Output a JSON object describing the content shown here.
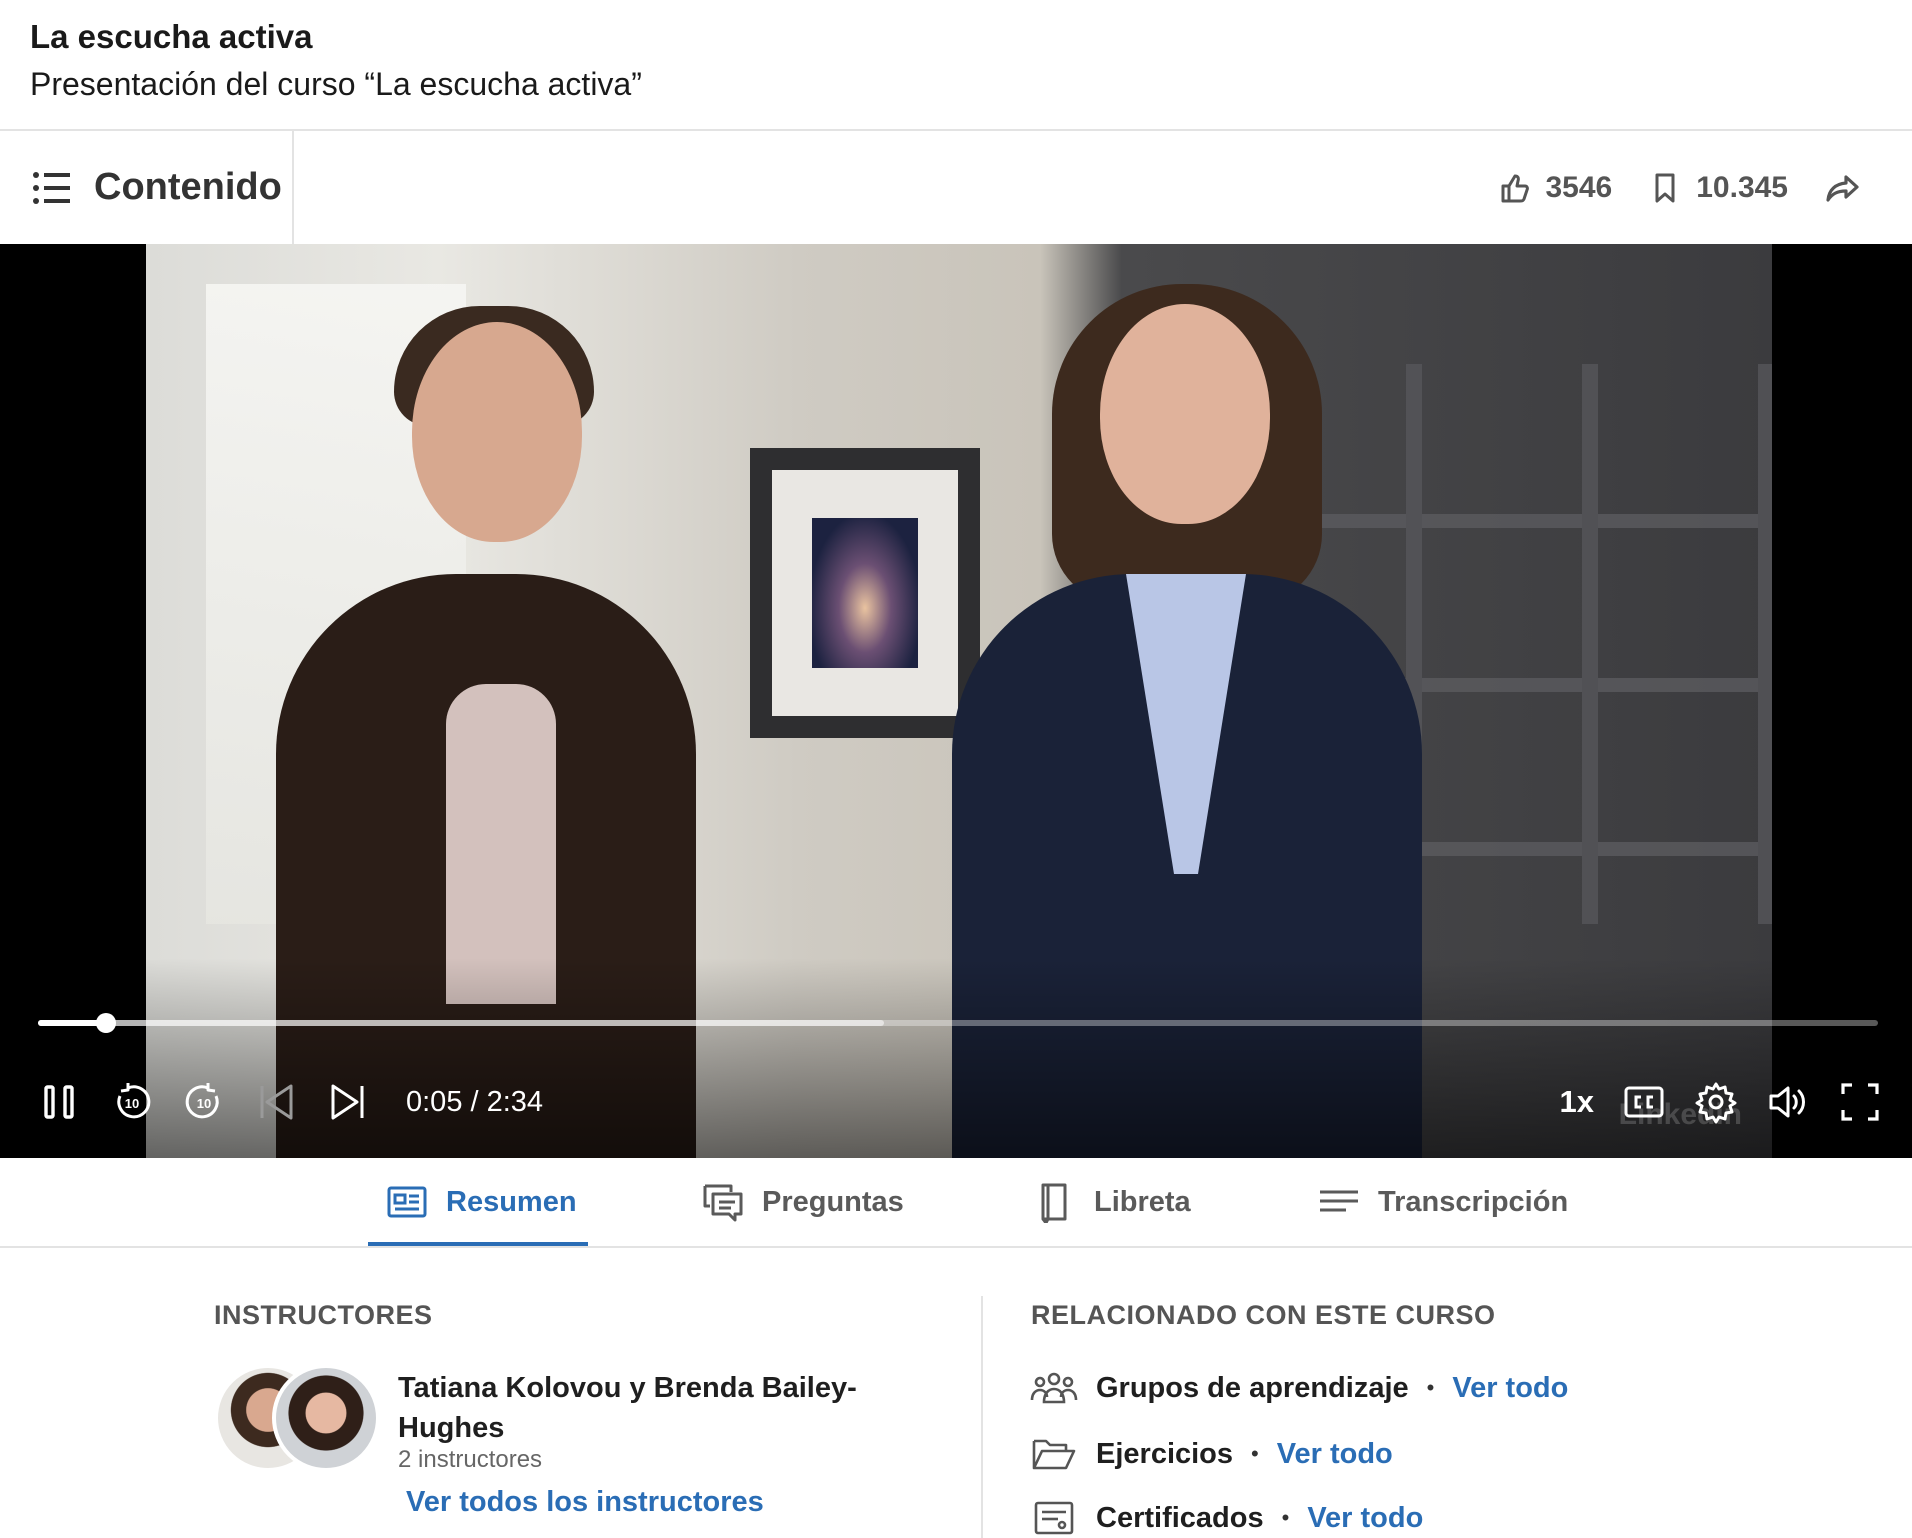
{
  "header": {
    "course_title": "La escucha activa",
    "lesson_title": "Presentación del curso “La escucha activa”"
  },
  "toolbar": {
    "contents_label": "Contenido",
    "likes": "3546",
    "saves": "10.345"
  },
  "player": {
    "time_display": "0:05 / 2:34",
    "speed": "1x",
    "progress_fraction": 0.037,
    "buffered_fraction": 0.46,
    "watermark": "Linkedin"
  },
  "tabs": [
    {
      "label": "Resumen",
      "icon": "summary-icon",
      "active": true
    },
    {
      "label": "Preguntas",
      "icon": "questions-icon",
      "active": false
    },
    {
      "label": "Libreta",
      "icon": "notebook-icon",
      "active": false
    },
    {
      "label": "Transcripción",
      "icon": "transcript-icon",
      "active": false
    }
  ],
  "instructors": {
    "heading": "INSTRUCTORES",
    "names": "Tatiana Kolovou y Brenda Bailey-Hughes",
    "count": "2 instructores",
    "see_all": "Ver todos los instructores"
  },
  "related": {
    "heading": "RELACIONADO CON ESTE CURSO",
    "items": [
      {
        "label": "Grupos de aprendizaje",
        "link": "Ver todo",
        "icon": "groups-icon"
      },
      {
        "label": "Ejercicios",
        "link": "Ver todo",
        "icon": "folder-icon"
      },
      {
        "label": "Certificados",
        "link": "Ver todo",
        "icon": "certificate-icon"
      }
    ]
  },
  "colors": {
    "accent": "#2a6db5",
    "text": "#1f1f1f",
    "muted": "#555555"
  }
}
